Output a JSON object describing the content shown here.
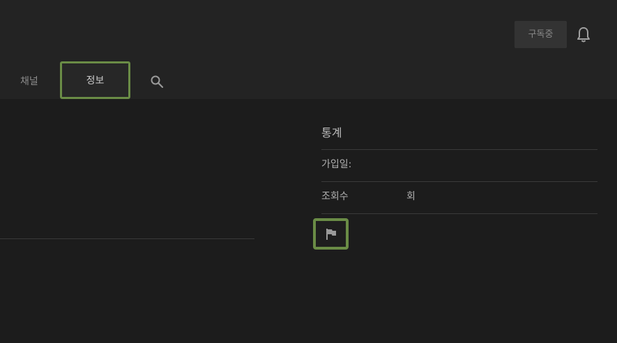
{
  "header": {
    "subscribe_label": "구독중",
    "bell_icon": "bell-icon"
  },
  "tabs": [
    {
      "label": "채널",
      "active": false
    },
    {
      "label": "정보",
      "active": true
    }
  ],
  "search_icon": "search-icon",
  "stats": {
    "title": "통계",
    "joined_label": "가입일:",
    "views_label": "조회수",
    "views_value": "회"
  },
  "flag_icon": "flag-icon",
  "colors": {
    "highlight": "#6a8c46",
    "header_bg": "#232323",
    "page_bg": "#1c1c1c"
  }
}
